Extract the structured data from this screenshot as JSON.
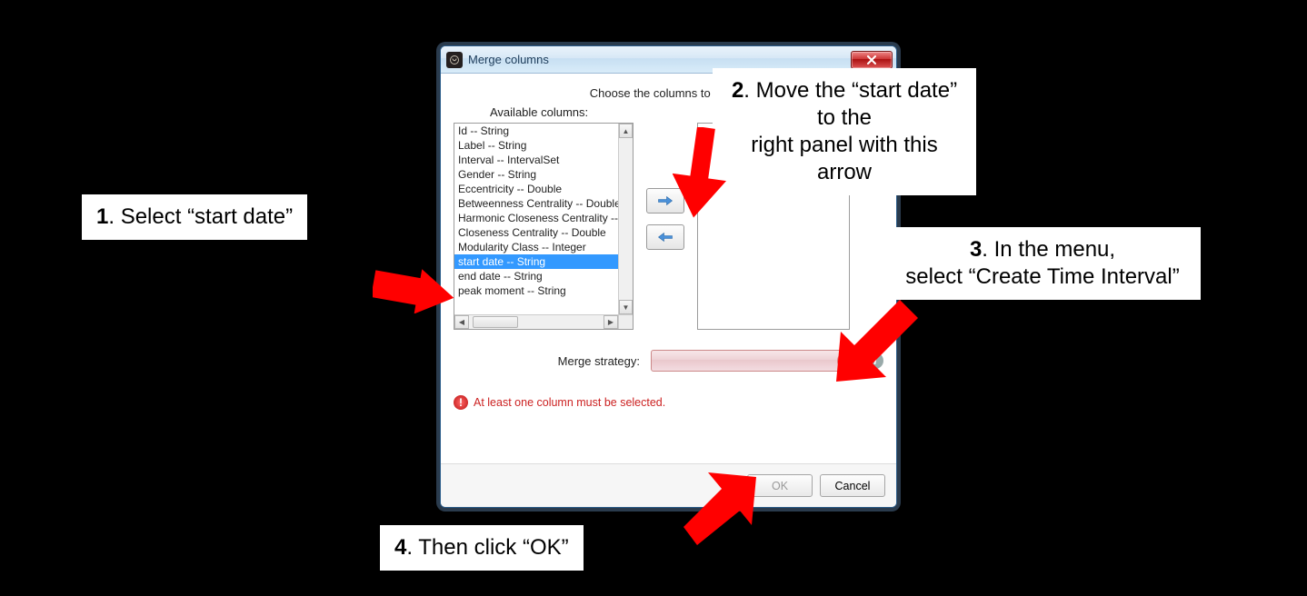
{
  "dialog": {
    "title": "Merge columns",
    "prompt": "Choose the columns to merge",
    "available_label": "Available columns:",
    "columns": [
      "Id -- String",
      "Label -- String",
      "Interval -- IntervalSet",
      "Gender -- String",
      "Eccentricity -- Double",
      "Betweenness Centrality -- Double",
      "Harmonic Closeness Centrality -- Double",
      "Closeness Centrality -- Double",
      "Modularity Class -- Integer",
      "start date -- String",
      "end date -- String",
      "peak moment -- String"
    ],
    "selected_index": 9,
    "strategy_label": "Merge strategy:",
    "strategy_value": "",
    "error_text": "At least one column must be selected.",
    "ok_label": "OK",
    "cancel_label": "Cancel"
  },
  "callouts": {
    "c1_num": "1",
    "c1_text": ". Select “start date”",
    "c2_num": "2",
    "c2_text_a": ". Move the “start date” to the",
    "c2_text_b": "right panel with this arrow",
    "c3_num": "3",
    "c3_text_a": ". In the menu,",
    "c3_text_b": "select “Create Time Interval”",
    "c4_num": "4",
    "c4_text": ". Then click “OK”"
  }
}
